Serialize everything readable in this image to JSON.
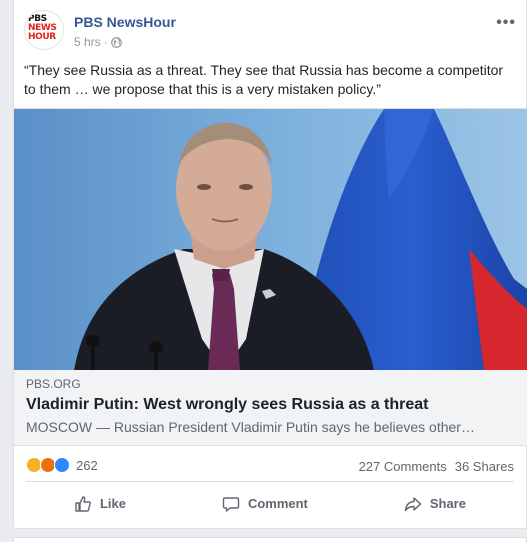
{
  "post": {
    "page_name": "PBS NewsHour",
    "avatar_logo": {
      "line1": "PBS",
      "line2": "NEWS",
      "line3": "HOUR"
    },
    "time": "5 hrs",
    "separator": "·",
    "privacy_icon": "globe-icon",
    "more_icon": "•••",
    "status_text": "“They see Russia as a threat. They see that Russia has become a competitor to them … we propose that this is a very mistaken policy.”"
  },
  "link": {
    "domain": "PBS.ORG",
    "title": "Vladimir Putin: West wrongly sees Russia as a threat",
    "description": "MOSCOW — Russian President Vladimir Putin says he believes other…"
  },
  "stats": {
    "reaction_icons": [
      "haha-icon",
      "angry-icon",
      "like-icon"
    ],
    "reaction_count": "262",
    "comments": "227 Comments",
    "shares": "36 Shares"
  },
  "actions": {
    "like": "Like",
    "comment": "Comment",
    "share": "Share"
  },
  "colors": {
    "link_blue": "#365899",
    "meta_gray": "#90949c",
    "link_meta_bg": "#f2f3f5",
    "page_bg": "#e9ebee"
  }
}
